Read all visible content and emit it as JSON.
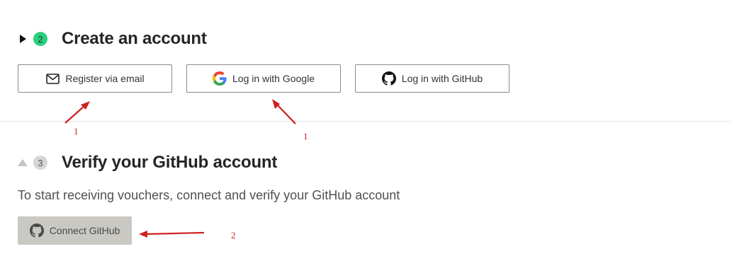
{
  "step2": {
    "number": "2",
    "title": "Create an account",
    "toggle_icon": "caret-right-icon",
    "buttons": {
      "email": {
        "label": "Register via email",
        "icon": "mail-icon"
      },
      "google": {
        "label": "Log in with Google",
        "icon": "google-icon"
      },
      "github": {
        "label": "Log in with GitHub",
        "icon": "github-icon"
      }
    }
  },
  "step3": {
    "number": "3",
    "title": "Verify your GitHub account",
    "toggle_icon": "caret-up-icon",
    "description": "To start receiving vouchers, connect and verify your GitHub account",
    "connect_button": {
      "label": "Connect GitHub",
      "icon": "github-icon"
    }
  },
  "annotations": [
    {
      "label": "1"
    },
    {
      "label": "1"
    },
    {
      "label": "2"
    }
  ],
  "colors": {
    "badge_active": "#2ccf7e",
    "badge_inactive": "#d6d6d6",
    "annotation": "#cc1f1f",
    "connect_button_bg": "#c9c8c3"
  }
}
